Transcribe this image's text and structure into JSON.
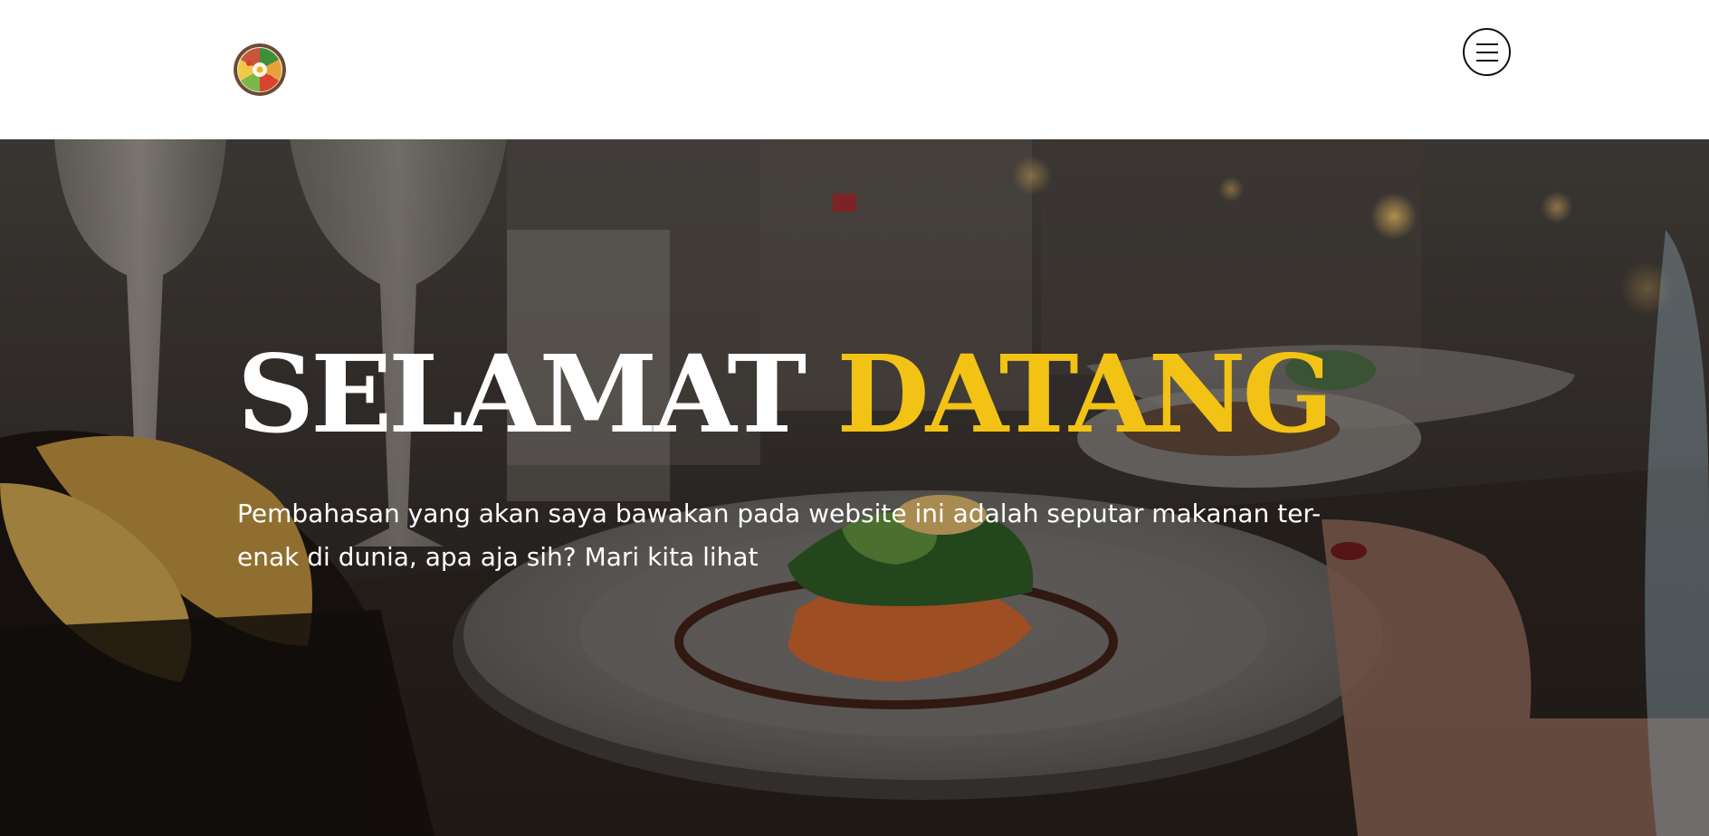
{
  "header": {
    "logo_icon": "food-bowl-logo-icon",
    "menu_icon": "hamburger-menu-icon"
  },
  "hero": {
    "title_part1": "SELAMAT",
    "title_part2": "DATANG",
    "subtitle": "Pembahasan yang akan saya bawakan pada website ini adalah seputar makanan ter-enak di dunia, apa aja sih? Mari kita lihat",
    "background_image": "restaurant-dining-table-photo"
  },
  "colors": {
    "accent": "#f2c315",
    "header_bg": "#ffffff",
    "hero_text": "#ffffff"
  }
}
